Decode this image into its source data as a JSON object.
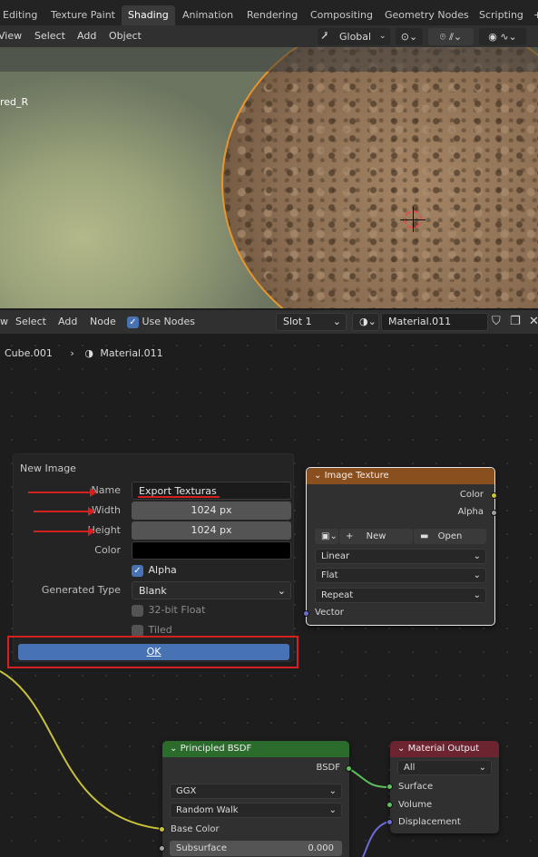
{
  "workspace_tabs": [
    "Editing",
    "Texture Paint",
    "Shading",
    "Animation",
    "Rendering",
    "Compositing",
    "Geometry Nodes",
    "Scripting"
  ],
  "active_tab": "Shading",
  "viewport_menu": {
    "view": "View",
    "select": "Select",
    "add": "Add",
    "object": "Object"
  },
  "transform_orientation": "Global",
  "viewport_overlay_text": "red_R",
  "node_menu": {
    "select": "Select",
    "add": "Add",
    "node": "Node",
    "use_nodes": "Use Nodes"
  },
  "slot": "Slot 1",
  "material_name": "Material.011",
  "breadcrumb": {
    "object": "Cube.001",
    "material": "Material.011"
  },
  "new_image": {
    "title": "New Image",
    "name_label": "Name",
    "name_value": "Export Texturas",
    "width_label": "Width",
    "width_value": "1024 px",
    "height_label": "Height",
    "height_value": "1024 px",
    "color_label": "Color",
    "color_value": "#000000",
    "alpha_label": "Alpha",
    "alpha_checked": true,
    "generated_type_label": "Generated Type",
    "generated_type_value": "Blank",
    "float_label": "32-bit Float",
    "float_checked": false,
    "tiled_label": "Tiled",
    "tiled_checked": false,
    "ok_label": "OK"
  },
  "image_texture": {
    "title": "Image Texture",
    "out_color": "Color",
    "out_alpha": "Alpha",
    "new_label": "New",
    "open_label": "Open",
    "interpolation": "Linear",
    "projection": "Flat",
    "extension": "Repeat",
    "in_vector": "Vector"
  },
  "principled": {
    "title": "Principled BSDF",
    "out_bsdf": "BSDF",
    "distribution": "GGX",
    "subsurface_method": "Random Walk",
    "in_base_color": "Base Color",
    "subsurface_label": "Subsurface",
    "subsurface_value": "0.000"
  },
  "material_output": {
    "title": "Material Output",
    "target": "All",
    "in_surface": "Surface",
    "in_volume": "Volume",
    "in_displacement": "Displacement"
  },
  "colors": {
    "accent": "#4772b3",
    "highlight": "#d32020",
    "texture_node_header": "#8a4f1f",
    "shader_node_header": "#2b6b2b",
    "output_node_header": "#6b2430",
    "selection_outline": "#e8962e"
  }
}
